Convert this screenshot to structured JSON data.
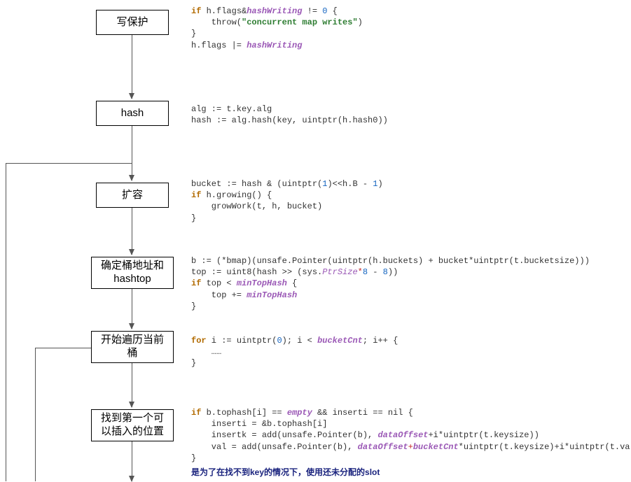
{
  "nodes": {
    "n1": "写保护",
    "n2": "hash",
    "n3": "扩容",
    "n4": "确定桶地址和 hashtop",
    "n5": "开始遍历当前桶",
    "n6": "找到第一个可以插入的位置"
  },
  "code1": {
    "l1a": "if",
    "l1b": " h.flags&",
    "l1c": "hashWriting",
    "l1d": " != ",
    "l1e": "0",
    "l1f": " {",
    "l2a": "    throw(",
    "l2b": "\"concurrent map writes\"",
    "l2c": ")",
    "l3": "}",
    "l4a": "h.flags |= ",
    "l4b": "hashWriting"
  },
  "code2": {
    "l1": "alg := t.key.alg",
    "l2": "hash := alg.hash(key, uintptr(h.hash0))"
  },
  "code3": {
    "l1a": "bucket := hash & (uintptr(",
    "l1b": "1",
    "l1c": ")<<h.B - ",
    "l1d": "1",
    "l1e": ")",
    "l2a": "if",
    "l2b": " h.growing() {",
    "l3": "    growWork(t, h, bucket)",
    "l4": "}"
  },
  "code4": {
    "l1": "b := (*bmap)(unsafe.Pointer(uintptr(h.buckets) + bucket*uintptr(t.bucketsize)))",
    "l2a": "top := uint8(hash >> (sys.",
    "l2b": "PtrSize",
    "l2c": "*",
    "l2d": "8",
    "l2e": " - ",
    "l2f": "8",
    "l2g": "))",
    "l3a": "if",
    "l3b": " top < ",
    "l3c": "minTopHash",
    "l3d": " {",
    "l4a": "    top += ",
    "l4b": "minTopHash",
    "l5": "}"
  },
  "code5": {
    "l1a": "for",
    "l1b": " i := uintptr(",
    "l1c": "0",
    "l1d": "); i < ",
    "l1e": "bucketCnt",
    "l1f": "; i++ {",
    "l2": "    ……",
    "l3": "}"
  },
  "code6": {
    "l1a": "if",
    "l1b": " b.tophash[i] == ",
    "l1c": "empty",
    "l1d": " && inserti == nil {",
    "l2": "    inserti = &b.tophash[i]",
    "l3a": "    insertk = add(unsafe.Pointer(b), ",
    "l3b": "dataOffset",
    "l3c": "+i*uintptr(t.keysize))",
    "l4a": "    val = add(unsafe.Pointer(b), ",
    "l4b": "dataOffset",
    "l4c": "+",
    "l4d": "bucketCnt",
    "l4e": "*uintptr(t.keysize)+i*uintptr(t.valuesize))",
    "l5": "}"
  },
  "note1": "是为了在找不到key的情况下，使用还未分配的slot"
}
